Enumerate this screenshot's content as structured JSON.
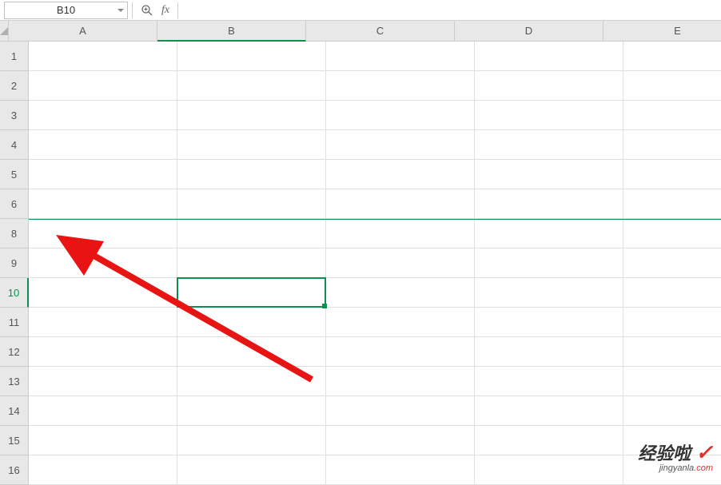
{
  "nameBox": {
    "value": "B10"
  },
  "formulaBar": {
    "value": ""
  },
  "columns": [
    "A",
    "B",
    "C",
    "D",
    "E"
  ],
  "rows": [
    "1",
    "2",
    "3",
    "4",
    "5",
    "6",
    "8",
    "9",
    "10",
    "11",
    "12",
    "13",
    "14",
    "15",
    "16"
  ],
  "activeColumn": "B",
  "activeRow": "10",
  "selection": {
    "cell": "B10"
  },
  "watermark": {
    "main": "经验啦",
    "sub_prefix": "jingyanla",
    "sub_suffix": ".com"
  }
}
